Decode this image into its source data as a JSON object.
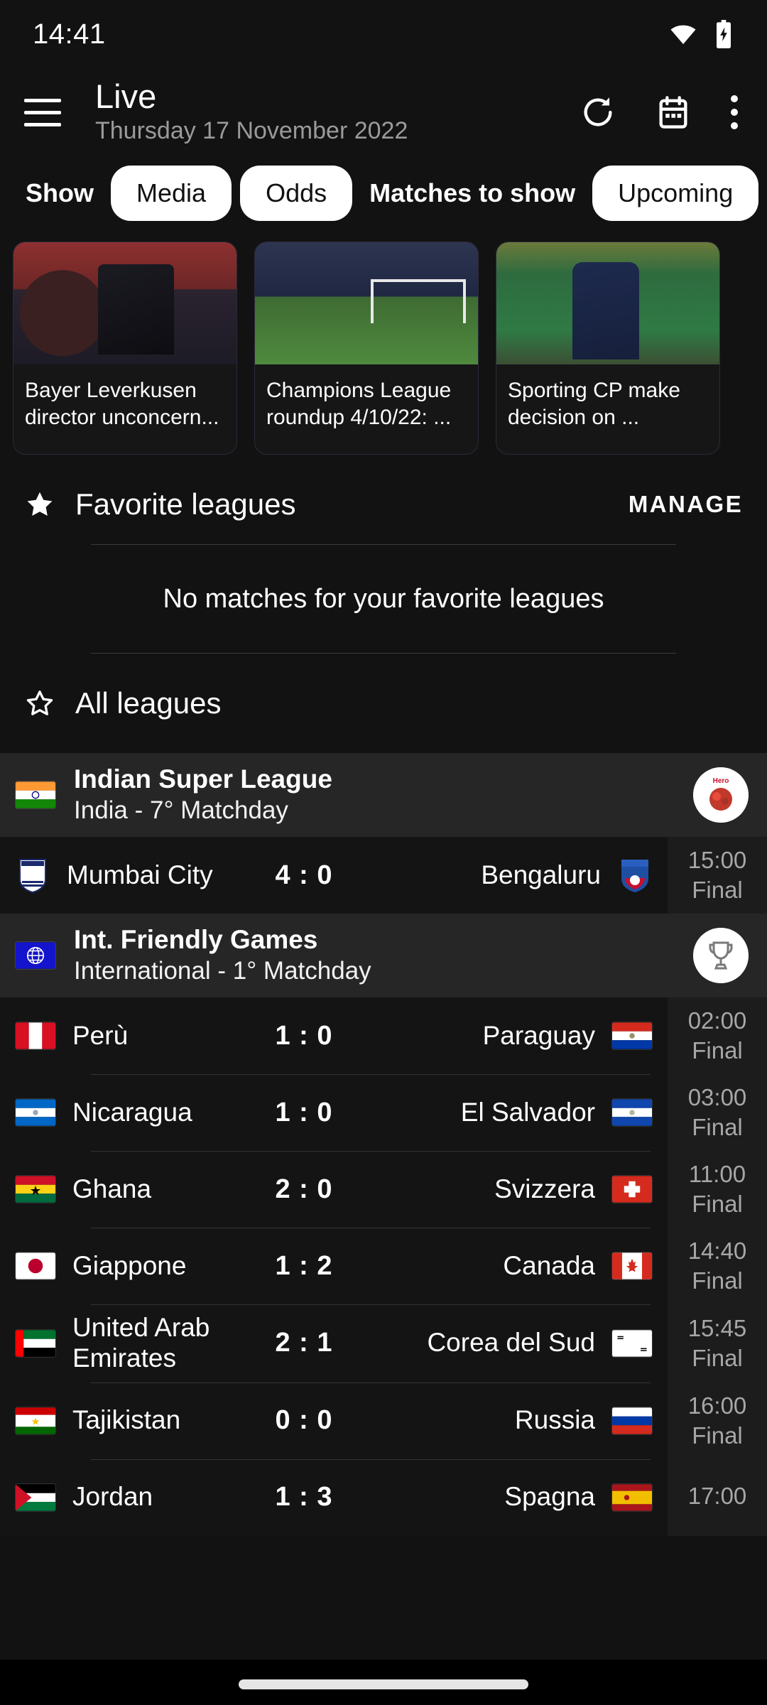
{
  "status_bar": {
    "time": "14:41",
    "wifi_icon": "wifi-icon",
    "battery_icon": "battery-charging-icon"
  },
  "app_bar": {
    "menu_icon": "hamburger-menu-icon",
    "title": "Live",
    "subtitle": "Thursday 17 November 2022",
    "refresh_icon": "refresh-icon",
    "calendar_icon": "calendar-icon",
    "overflow_icon": "more-vertical-icon"
  },
  "filters": {
    "show_label": "Show",
    "chips": [
      "Media",
      "Odds"
    ],
    "matches_label": "Matches to show",
    "upcoming_chip": "Upcoming"
  },
  "news": {
    "cards": [
      {
        "title": "Bayer Leverkusen director unconcern..."
      },
      {
        "title": "Champions League roundup 4/10/22: ..."
      },
      {
        "title": "Sporting CP make decision on ..."
      }
    ]
  },
  "favorite_leagues": {
    "star_icon": "star-filled-icon",
    "title": "Favorite leagues",
    "manage_label": "MANAGE",
    "empty_text": "No matches for your favorite leagues"
  },
  "all_leagues": {
    "star_icon": "star-outline-icon",
    "title": "All leagues"
  },
  "leagues": [
    {
      "flag": "india-flag",
      "name": "Indian Super League",
      "subtitle": "India - 7° Matchday",
      "logo": "indian-super-league-logo",
      "matches": [
        {
          "home": "Mumbai City",
          "away": "Bengaluru",
          "home_score": "4",
          "away_score": "0",
          "time": "15:00",
          "status": "Final",
          "home_crest": "mumbai-city-crest",
          "away_crest": "bengaluru-crest"
        }
      ]
    },
    {
      "flag": "international-flag",
      "name": "Int. Friendly Games",
      "subtitle": "International - 1° Matchday",
      "logo": "trophy-icon",
      "matches": [
        {
          "home": "Perù",
          "away": "Paraguay",
          "home_score": "1",
          "away_score": "0",
          "time": "02:00",
          "status": "Final",
          "home_crest": "peru-flag",
          "away_crest": "paraguay-flag"
        },
        {
          "home": "Nicaragua",
          "away": "El Salvador",
          "home_score": "1",
          "away_score": "0",
          "time": "03:00",
          "status": "Final",
          "home_crest": "nicaragua-flag",
          "away_crest": "el-salvador-flag"
        },
        {
          "home": "Ghana",
          "away": "Svizzera",
          "home_score": "2",
          "away_score": "0",
          "time": "11:00",
          "status": "Final",
          "home_crest": "ghana-flag",
          "away_crest": "switzerland-flag"
        },
        {
          "home": "Giappone",
          "away": "Canada",
          "home_score": "1",
          "away_score": "2",
          "time": "14:40",
          "status": "Final",
          "home_crest": "japan-flag",
          "away_crest": "canada-flag"
        },
        {
          "home": "United Arab Emirates",
          "away": "Corea del Sud",
          "home_score": "2",
          "away_score": "1",
          "time": "15:45",
          "status": "Final",
          "home_crest": "uae-flag",
          "away_crest": "south-korea-flag"
        },
        {
          "home": "Tajikistan",
          "away": "Russia",
          "home_score": "0",
          "away_score": "0",
          "time": "16:00",
          "status": "Final",
          "home_crest": "tajikistan-flag",
          "away_crest": "russia-flag"
        },
        {
          "home": "Jordan",
          "away": "Spagna",
          "home_score": "1",
          "away_score": "3",
          "time": "17:00",
          "status": "",
          "home_crest": "jordan-flag",
          "away_crest": "spain-flag"
        }
      ]
    }
  ],
  "score_separator": ":",
  "colors": {
    "background": "#121212",
    "league_header_bg": "#262626",
    "match_row_bg": "#141414",
    "time_column_bg": "#1c1c1c",
    "chip_bg": "#ffffff",
    "text_primary": "#ffffff",
    "text_secondary": "#a7a7a7"
  }
}
